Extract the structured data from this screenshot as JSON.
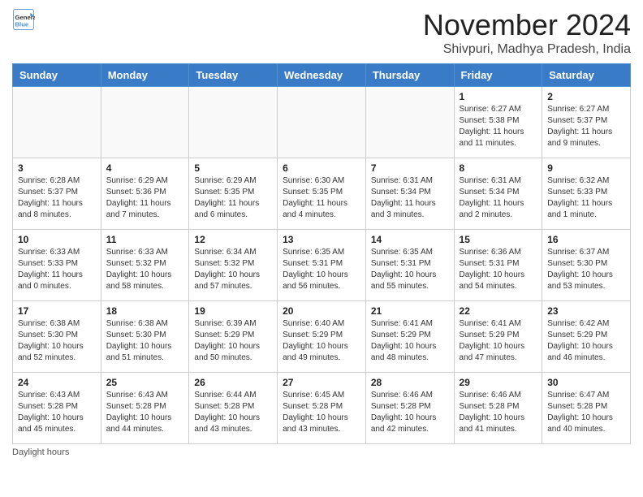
{
  "logo": {
    "line1": "General",
    "line2": "Blue"
  },
  "title": "November 2024",
  "location": "Shivpuri, Madhya Pradesh, India",
  "days_of_week": [
    "Sunday",
    "Monday",
    "Tuesday",
    "Wednesday",
    "Thursday",
    "Friday",
    "Saturday"
  ],
  "weeks": [
    [
      {
        "day": "",
        "info": ""
      },
      {
        "day": "",
        "info": ""
      },
      {
        "day": "",
        "info": ""
      },
      {
        "day": "",
        "info": ""
      },
      {
        "day": "",
        "info": ""
      },
      {
        "day": "1",
        "info": "Sunrise: 6:27 AM\nSunset: 5:38 PM\nDaylight: 11 hours and 11 minutes."
      },
      {
        "day": "2",
        "info": "Sunrise: 6:27 AM\nSunset: 5:37 PM\nDaylight: 11 hours and 9 minutes."
      }
    ],
    [
      {
        "day": "3",
        "info": "Sunrise: 6:28 AM\nSunset: 5:37 PM\nDaylight: 11 hours and 8 minutes."
      },
      {
        "day": "4",
        "info": "Sunrise: 6:29 AM\nSunset: 5:36 PM\nDaylight: 11 hours and 7 minutes."
      },
      {
        "day": "5",
        "info": "Sunrise: 6:29 AM\nSunset: 5:35 PM\nDaylight: 11 hours and 6 minutes."
      },
      {
        "day": "6",
        "info": "Sunrise: 6:30 AM\nSunset: 5:35 PM\nDaylight: 11 hours and 4 minutes."
      },
      {
        "day": "7",
        "info": "Sunrise: 6:31 AM\nSunset: 5:34 PM\nDaylight: 11 hours and 3 minutes."
      },
      {
        "day": "8",
        "info": "Sunrise: 6:31 AM\nSunset: 5:34 PM\nDaylight: 11 hours and 2 minutes."
      },
      {
        "day": "9",
        "info": "Sunrise: 6:32 AM\nSunset: 5:33 PM\nDaylight: 11 hours and 1 minute."
      }
    ],
    [
      {
        "day": "10",
        "info": "Sunrise: 6:33 AM\nSunset: 5:33 PM\nDaylight: 11 hours and 0 minutes."
      },
      {
        "day": "11",
        "info": "Sunrise: 6:33 AM\nSunset: 5:32 PM\nDaylight: 10 hours and 58 minutes."
      },
      {
        "day": "12",
        "info": "Sunrise: 6:34 AM\nSunset: 5:32 PM\nDaylight: 10 hours and 57 minutes."
      },
      {
        "day": "13",
        "info": "Sunrise: 6:35 AM\nSunset: 5:31 PM\nDaylight: 10 hours and 56 minutes."
      },
      {
        "day": "14",
        "info": "Sunrise: 6:35 AM\nSunset: 5:31 PM\nDaylight: 10 hours and 55 minutes."
      },
      {
        "day": "15",
        "info": "Sunrise: 6:36 AM\nSunset: 5:31 PM\nDaylight: 10 hours and 54 minutes."
      },
      {
        "day": "16",
        "info": "Sunrise: 6:37 AM\nSunset: 5:30 PM\nDaylight: 10 hours and 53 minutes."
      }
    ],
    [
      {
        "day": "17",
        "info": "Sunrise: 6:38 AM\nSunset: 5:30 PM\nDaylight: 10 hours and 52 minutes."
      },
      {
        "day": "18",
        "info": "Sunrise: 6:38 AM\nSunset: 5:30 PM\nDaylight: 10 hours and 51 minutes."
      },
      {
        "day": "19",
        "info": "Sunrise: 6:39 AM\nSunset: 5:29 PM\nDaylight: 10 hours and 50 minutes."
      },
      {
        "day": "20",
        "info": "Sunrise: 6:40 AM\nSunset: 5:29 PM\nDaylight: 10 hours and 49 minutes."
      },
      {
        "day": "21",
        "info": "Sunrise: 6:41 AM\nSunset: 5:29 PM\nDaylight: 10 hours and 48 minutes."
      },
      {
        "day": "22",
        "info": "Sunrise: 6:41 AM\nSunset: 5:29 PM\nDaylight: 10 hours and 47 minutes."
      },
      {
        "day": "23",
        "info": "Sunrise: 6:42 AM\nSunset: 5:29 PM\nDaylight: 10 hours and 46 minutes."
      }
    ],
    [
      {
        "day": "24",
        "info": "Sunrise: 6:43 AM\nSunset: 5:28 PM\nDaylight: 10 hours and 45 minutes."
      },
      {
        "day": "25",
        "info": "Sunrise: 6:43 AM\nSunset: 5:28 PM\nDaylight: 10 hours and 44 minutes."
      },
      {
        "day": "26",
        "info": "Sunrise: 6:44 AM\nSunset: 5:28 PM\nDaylight: 10 hours and 43 minutes."
      },
      {
        "day": "27",
        "info": "Sunrise: 6:45 AM\nSunset: 5:28 PM\nDaylight: 10 hours and 43 minutes."
      },
      {
        "day": "28",
        "info": "Sunrise: 6:46 AM\nSunset: 5:28 PM\nDaylight: 10 hours and 42 minutes."
      },
      {
        "day": "29",
        "info": "Sunrise: 6:46 AM\nSunset: 5:28 PM\nDaylight: 10 hours and 41 minutes."
      },
      {
        "day": "30",
        "info": "Sunrise: 6:47 AM\nSunset: 5:28 PM\nDaylight: 10 hours and 40 minutes."
      }
    ]
  ],
  "footer": "Daylight hours"
}
